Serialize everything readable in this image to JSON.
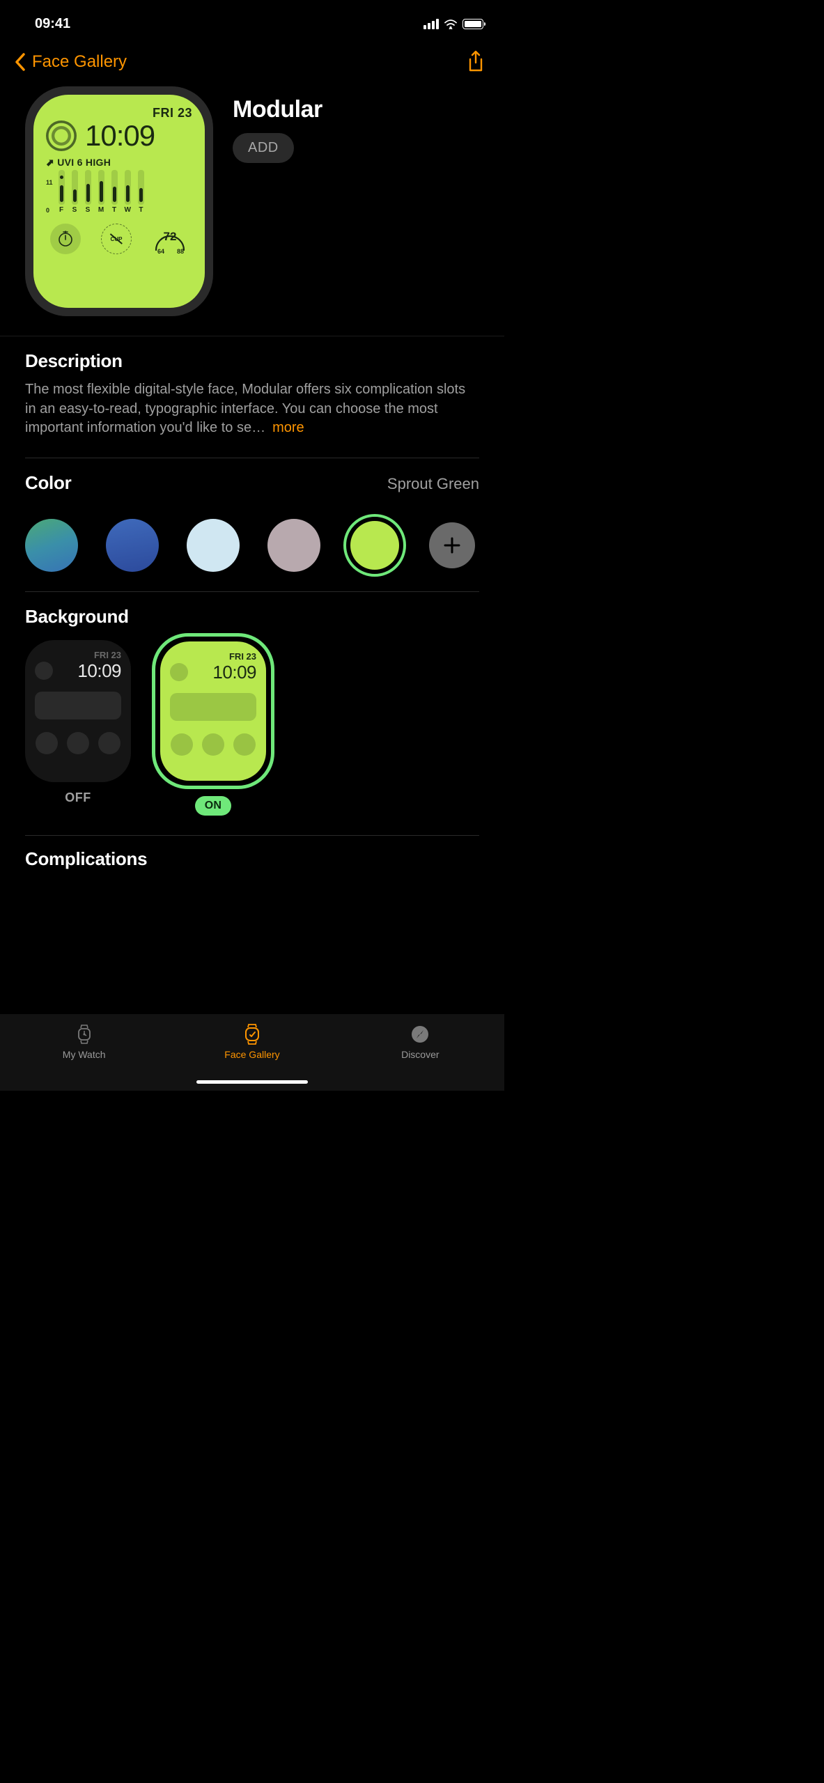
{
  "statusBar": {
    "time": "09:41"
  },
  "nav": {
    "backLabel": "Face Gallery"
  },
  "hero": {
    "title": "Modular",
    "addLabel": "ADD",
    "preview": {
      "date": "FRI 23",
      "time": "10:09",
      "uvi": "⬈ UVI 6 HIGH",
      "axisTop": "11",
      "axisBottom": "0",
      "days": [
        "F",
        "S",
        "S",
        "M",
        "T",
        "W",
        "T"
      ],
      "centerCompText": "CUP",
      "weatherTemp": "72",
      "weatherLow": "64",
      "weatherHigh": "88"
    }
  },
  "description": {
    "heading": "Description",
    "text": "The most flexible digital-style face, Modular offers six complication slots in an easy-to-read, typographic interface. You can choose the most important information you'd like to se…",
    "moreLabel": "more"
  },
  "color": {
    "heading": "Color",
    "selectedName": "Sprout Green",
    "options": [
      "teal-gradient",
      "blue",
      "light-blue",
      "gray",
      "sprout-green"
    ]
  },
  "background": {
    "heading": "Background",
    "thumbDate": "FRI 23",
    "thumbTime": "10:09",
    "offLabel": "OFF",
    "onLabel": "ON"
  },
  "complications": {
    "heading": "Complications"
  },
  "tabs": {
    "mywatch": "My Watch",
    "gallery": "Face Gallery",
    "discover": "Discover"
  }
}
